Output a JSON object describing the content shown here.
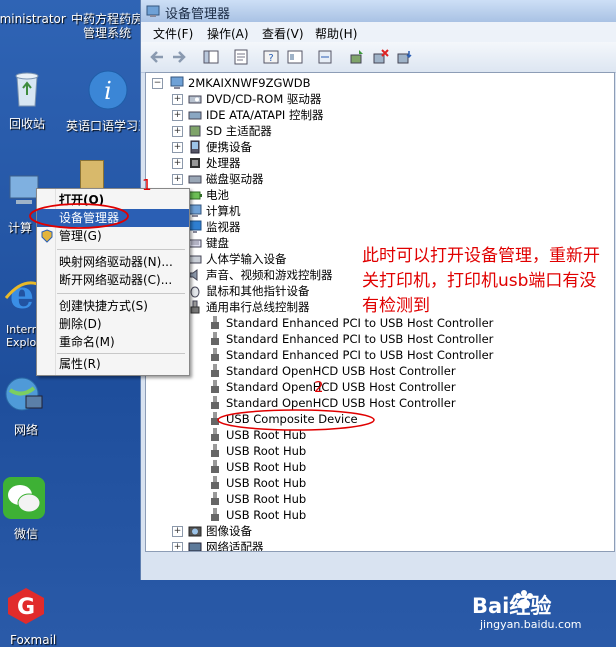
{
  "desktop": {
    "icons": [
      {
        "label": "Administrator",
        "name": "user-folder-icon"
      },
      {
        "label": "中药方程药房管理系统",
        "name": "app-icon"
      },
      {
        "label": "回收站",
        "name": "recycle-bin-icon"
      },
      {
        "label": "英语口语学习王",
        "name": "info-app-icon"
      },
      {
        "label": "计算",
        "name": "computer-icon"
      },
      {
        "label": "Internet Explorer",
        "name": "ie-icon"
      },
      {
        "label": "网络",
        "name": "network-icon"
      },
      {
        "label": "微信",
        "name": "wechat-icon"
      },
      {
        "label": "Foxmail",
        "name": "foxmail-icon"
      }
    ]
  },
  "window": {
    "title": "设备管理器",
    "menu": [
      "文件(F)",
      "操作(A)",
      "查看(V)",
      "帮助(H)"
    ]
  },
  "tree": {
    "root": "2MKAIXNWF9ZGWDB",
    "categories": [
      "DVD/CD-ROM 驱动器",
      "IDE ATA/ATAPI 控制器",
      "SD 主适配器",
      "便携设备",
      "处理器",
      "磁盘驱动器",
      "电池",
      "计算机",
      "监视器",
      "键盘",
      "人体学输入设备",
      "声音、视频和游戏控制器",
      "鼠标和其他指针设备",
      "通用串行总线控制器"
    ],
    "usb_children": [
      "Standard Enhanced PCI to USB Host Controller",
      "Standard Enhanced PCI to USB Host Controller",
      "Standard Enhanced PCI to USB Host Controller",
      "Standard OpenHCD USB Host Controller",
      "Standard OpenHCD USB Host Controller",
      "Standard OpenHCD USB Host Controller",
      "USB Composite Device",
      "USB Root Hub",
      "USB Root Hub",
      "USB Root Hub",
      "USB Root Hub",
      "USB Root Hub",
      "USB Root Hub"
    ],
    "after": [
      "图像设备",
      "网络适配器"
    ]
  },
  "context_menu": {
    "items": [
      "打开(O)",
      "设备管理器",
      "管理(G)",
      "映射网络驱动器(N)...",
      "断开网络驱动器(C)...",
      "创建快捷方式(S)",
      "删除(D)",
      "重命名(M)",
      "属性(R)"
    ]
  },
  "annotations": {
    "num1": "1",
    "num2": "2",
    "note": "此时可以打开设备管理，重新开关打印机，打印机usb端口有没有检测到"
  },
  "watermark": {
    "brand": "Bai经验",
    "url": "jingyan.baidu.com"
  },
  "colors": {
    "annotation": "#e00000",
    "selection": "#2b5fb4"
  }
}
